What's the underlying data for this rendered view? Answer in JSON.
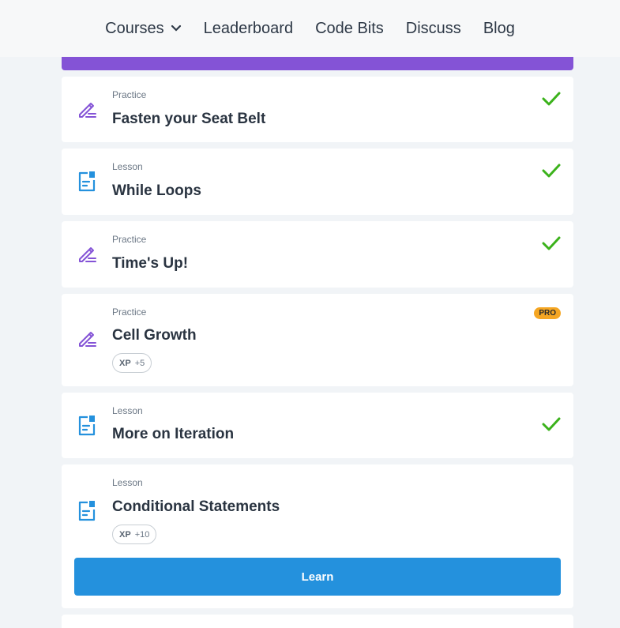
{
  "nav": {
    "items": [
      {
        "label": "Courses"
      },
      {
        "label": "Leaderboard"
      },
      {
        "label": "Code Bits"
      },
      {
        "label": "Discuss"
      },
      {
        "label": "Blog"
      }
    ]
  },
  "colors": {
    "accent_purple": "#8453d6",
    "check_green": "#3bb21b",
    "lesson_blue": "#2491dd",
    "pro_orange": "#f5a623"
  },
  "items": [
    {
      "kind": "Practice",
      "title": "Fasten your Seat Belt",
      "icon": "practice-pencil-icon",
      "status": "completed"
    },
    {
      "kind": "Lesson",
      "title": "While Loops",
      "icon": "lesson-document-icon",
      "status": "completed"
    },
    {
      "kind": "Practice",
      "title": "Time's Up!",
      "icon": "practice-pencil-icon",
      "status": "completed"
    },
    {
      "kind": "Practice",
      "title": "Cell Growth",
      "icon": "practice-pencil-icon",
      "status": "pro",
      "badge": "PRO",
      "xp_label": "XP",
      "xp_value": "+5"
    },
    {
      "kind": "Lesson",
      "title": "More on Iteration",
      "icon": "lesson-document-icon",
      "status": "completed"
    },
    {
      "kind": "Lesson",
      "title": "Conditional Statements",
      "icon": "lesson-document-icon",
      "status": "current",
      "xp_label": "XP",
      "xp_value": "+10",
      "action_label": "Learn"
    }
  ]
}
